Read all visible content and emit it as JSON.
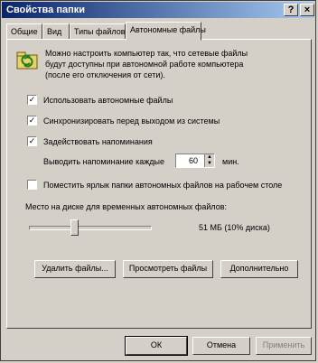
{
  "window": {
    "title": "Свойства папки",
    "help_label": "?",
    "close_label": "×"
  },
  "tabs": [
    {
      "label": "Общие"
    },
    {
      "label": "Вид"
    },
    {
      "label": "Типы файлов"
    },
    {
      "label": "Автономные файлы"
    }
  ],
  "description": {
    "line1": "Можно настроить компьютер так, что сетевые файлы",
    "line2": "будут доступны при автономной работе компьютера",
    "line3": "(после его отключения от сети)."
  },
  "options": {
    "use_offline": {
      "label": "Использовать автономные файлы",
      "checked": true
    },
    "sync_on_logoff": {
      "label": "Синхронизировать перед выходом из системы",
      "checked": true
    },
    "enable_reminders": {
      "label": "Задействовать напоминания",
      "checked": true
    },
    "reminder_prefix": "Выводить напоминание каждые",
    "reminder_value": "60",
    "reminder_unit": "мин.",
    "desktop_shortcut": {
      "label": "Поместить ярлык папки автономных файлов на рабочем столе",
      "checked": false
    }
  },
  "disk": {
    "label": "Место на диске для временных автономных файлов:",
    "value_text": "51 МБ (10% диска)",
    "percent": 10
  },
  "actions": {
    "delete": "Удалить файлы...",
    "view": "Просмотреть файлы",
    "advanced": "Дополнительно"
  },
  "footer": {
    "ok": "ОК",
    "cancel": "Отмена",
    "apply": "Применить"
  }
}
